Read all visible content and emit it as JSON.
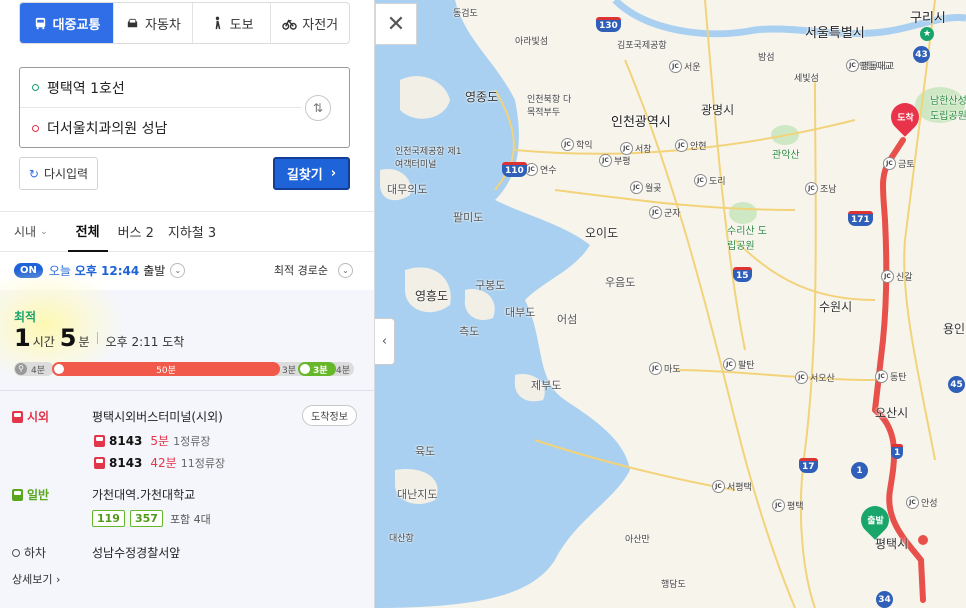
{
  "transport_modes": [
    {
      "label": "대중교통",
      "icon": "bus-icon",
      "selected": true
    },
    {
      "label": "자동차",
      "icon": "car-icon",
      "selected": false
    },
    {
      "label": "도보",
      "icon": "walk-icon",
      "selected": false
    },
    {
      "label": "자전거",
      "icon": "bicycle-icon",
      "selected": false
    }
  ],
  "route": {
    "origin": "평택역 1호선",
    "destination": "더서울치과의원 성남"
  },
  "buttons": {
    "reset": "다시입력",
    "search": "길찾기"
  },
  "filters": {
    "region": "시내",
    "tabs": [
      "전체",
      "버스 2",
      "지하철 3"
    ],
    "active_tab": "전체"
  },
  "departure": {
    "badge": "ON",
    "prefix": "오늘",
    "time": "오후 12:44",
    "suffix": "출발",
    "sort": "최적 경로순"
  },
  "result": {
    "tag": "최적",
    "hours": "1",
    "hours_unit": "시간",
    "minutes": "5",
    "minutes_unit": "분",
    "arrival": "오후 2:11 도착",
    "timeline": [
      {
        "kind": "walk",
        "label": "4분"
      },
      {
        "kind": "intercity-bus",
        "label": "50분"
      },
      {
        "kind": "walk",
        "label": "3분"
      },
      {
        "kind": "city-bus",
        "label": "3분"
      },
      {
        "kind": "walk",
        "label": "4분"
      }
    ],
    "segments": [
      {
        "type": "시외",
        "stop": "평택시외버스터미널(시외)",
        "action": "도착정보",
        "buses": [
          {
            "number": "8143",
            "wait": "5분",
            "stops": "1정류장"
          },
          {
            "number": "8143",
            "wait": "42분",
            "stops": "11정류장"
          }
        ]
      },
      {
        "type": "일반",
        "stop": "가천대역.가천대학교",
        "chips": [
          "119",
          "357"
        ],
        "included": "포함 4대"
      },
      {
        "type": "하차",
        "stop": "성남수정경찰서앞"
      }
    ],
    "detail_link": "상세보기"
  },
  "map": {
    "close": "✕",
    "collapse": "‹",
    "destination_pin": "도착",
    "origin_pin": "출발",
    "colors": {
      "route": "#e8504b",
      "sea": "#a9d0f0",
      "land": "#f7f4ec"
    },
    "labels": [
      {
        "text": "동검도",
        "kind": "small"
      },
      {
        "text": "아라빛섬",
        "kind": "small"
      },
      {
        "text": "김포국제공항",
        "kind": "small"
      },
      {
        "text": "서울특별시",
        "kind": "big"
      },
      {
        "text": "구리시",
        "kind": "big"
      },
      {
        "text": "밤섬",
        "kind": "small"
      },
      {
        "text": "세빛섬",
        "kind": "small"
      },
      {
        "text": "영동대교",
        "kind": "small"
      },
      {
        "text": "영종도",
        "kind": "normal"
      },
      {
        "text": "인천광역시",
        "kind": "big"
      },
      {
        "text": "광명시",
        "kind": "normal"
      },
      {
        "text": "인천국제공항 제1여객터미널",
        "kind": "small"
      },
      {
        "text": "인천북항 다목적부두",
        "kind": "small"
      },
      {
        "text": "대무의도",
        "kind": "sea"
      },
      {
        "text": "팔미도",
        "kind": "sea"
      },
      {
        "text": "오이도",
        "kind": "normal"
      },
      {
        "text": "영흥도",
        "kind": "normal"
      },
      {
        "text": "구봉도",
        "kind": "sea"
      },
      {
        "text": "대부도",
        "kind": "sea"
      },
      {
        "text": "우음도",
        "kind": "sea"
      },
      {
        "text": "수원시",
        "kind": "normal"
      },
      {
        "text": "용인",
        "kind": "normal"
      },
      {
        "text": "측도",
        "kind": "sea"
      },
      {
        "text": "어섬",
        "kind": "sea"
      },
      {
        "text": "제부도",
        "kind": "sea"
      },
      {
        "text": "오산시",
        "kind": "normal"
      },
      {
        "text": "육도",
        "kind": "sea"
      },
      {
        "text": "대난지도",
        "kind": "sea"
      },
      {
        "text": "아산만",
        "kind": "small"
      },
      {
        "text": "대산항",
        "kind": "small"
      },
      {
        "text": "평택시",
        "kind": "normal"
      },
      {
        "text": "행담도",
        "kind": "small"
      },
      {
        "text": "남한산성 도립공원",
        "kind": "park"
      },
      {
        "text": "관악산",
        "kind": "park"
      },
      {
        "text": "수리산 도립공원",
        "kind": "park"
      }
    ],
    "junctions": [
      "서운",
      "부평",
      "학익",
      "서창",
      "안현",
      "연수",
      "도리",
      "조남",
      "월곶",
      "군자",
      "금토",
      "신갈",
      "팔탄",
      "마도",
      "서오산",
      "동탄",
      "서평택",
      "평택",
      "안성",
      "영동대교"
    ],
    "highway_shields": [
      "130",
      "110",
      "15",
      "171",
      "17",
      "1",
      "43",
      "45",
      "34",
      "1"
    ]
  }
}
